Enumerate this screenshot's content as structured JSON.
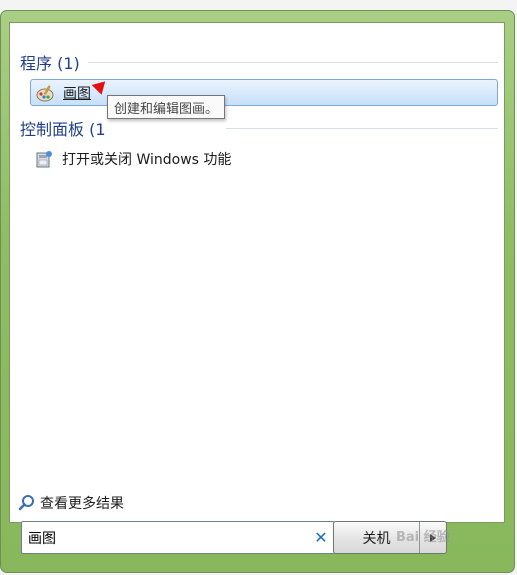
{
  "programs_group": {
    "title": "程序 (1)"
  },
  "programs_items": [
    {
      "label": "画图",
      "icon": "paint-palette-icon"
    }
  ],
  "tooltip": {
    "text": "创建和编辑图画。"
  },
  "control_group": {
    "title": "控制面板 (1"
  },
  "control_items": [
    {
      "label": "打开或关闭 Windows 功能",
      "icon": "windows-features-icon"
    }
  ],
  "more_results": {
    "label": "查看更多结果",
    "icon": "magnifier-icon"
  },
  "search": {
    "value": "画图",
    "clear_icon": "clear-x-icon"
  },
  "shutdown": {
    "label": "关机",
    "menu_icon": "chevron-right-icon"
  },
  "watermark": {
    "text": "Bai 经验"
  },
  "colors": {
    "accent": "#1f3f8c",
    "selection": "#c7e0fa",
    "frame": "#8fbd63",
    "arrow": "#e51010"
  }
}
